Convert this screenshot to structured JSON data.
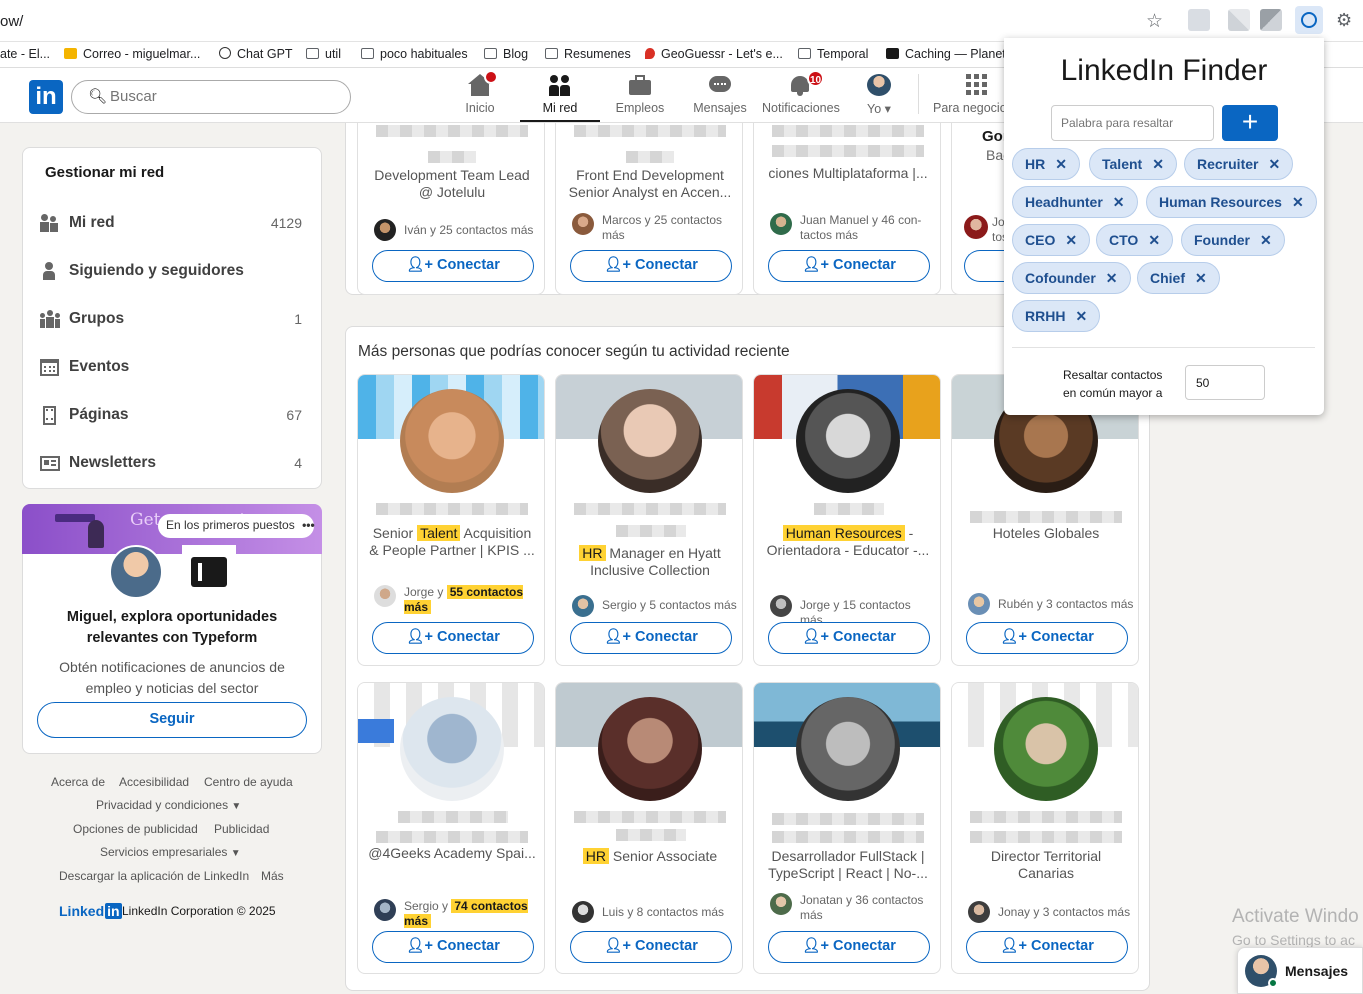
{
  "browser": {
    "url": "ow/",
    "bookmarks": [
      "ate - El...",
      "Correo - miguelmar...",
      "Chat GPT",
      "util",
      "poco habituales",
      "Blog",
      "Resumenes",
      "GeoGuessr - Let's e...",
      "Temporal",
      "Caching — PlanetS"
    ]
  },
  "nav": {
    "search_placeholder": "Buscar",
    "items": [
      {
        "label": "Inicio",
        "icon": "home-icon",
        "badge": ""
      },
      {
        "label": "Mi red",
        "icon": "network-icon",
        "badge": ""
      },
      {
        "label": "Empleos",
        "icon": "briefcase-icon",
        "badge": ""
      },
      {
        "label": "Mensajes",
        "icon": "chat-icon",
        "badge": ""
      },
      {
        "label": "Notificaciones",
        "icon": "bell-icon",
        "badge": "10"
      },
      {
        "label": "Yo",
        "icon": "avatar",
        "badge": ""
      },
      {
        "label": "Para negocios",
        "icon": "grid-icon",
        "badge": ""
      }
    ]
  },
  "sidebar": {
    "title": "Gestionar mi red",
    "items": [
      {
        "label": "Mi red",
        "count": "4129"
      },
      {
        "label": "Siguiendo y seguidores",
        "count": ""
      },
      {
        "label": "Grupos",
        "count": "1"
      },
      {
        "label": "Eventos",
        "count": ""
      },
      {
        "label": "Páginas",
        "count": "67"
      },
      {
        "label": "Newsletters",
        "count": "4"
      }
    ],
    "ad": {
      "banner_text": "Get your customers",
      "pill": "En los primeros puestos",
      "title": "Miguel, explora oportunidades relevantes con Typeform",
      "subtitle": "Obtén notificaciones de anuncios de empleo y noticias del sector",
      "button": "Seguir"
    },
    "footer": {
      "links": [
        "Acerca de",
        "Accesibilidad",
        "Centro de ayuda",
        "Privacidad y condiciones",
        "Opciones de publicidad",
        "Publicidad",
        "Servicios empresariales",
        "Descargar la aplicación de LinkedIn",
        "Más"
      ],
      "brand": "Linked",
      "brand_in": "in",
      "copyright": "LinkedIn Corporation © 2025"
    }
  },
  "top_row": [
    {
      "desc": "Development Team Lead @ Jotelulu",
      "mutual": "Iván y 25 contactos más",
      "button": "Conectar"
    },
    {
      "desc": "Front End Development Senior Analyst en Accen...",
      "mutual": "Marcos y 25 contactos más",
      "button": "Conectar"
    },
    {
      "desc": "ciones Multiplataforma |...",
      "mutual": "Juan Manuel y 46 con-tactos más",
      "button": "Conectar"
    },
    {
      "desc": "Gor",
      "desc2": "Bac",
      "mutual": "Jo tos",
      "button": "Conectar"
    }
  ],
  "section": {
    "title": "Más personas que podrías conocer según tu actividad reciente",
    "row1": [
      {
        "pre": "Senior ",
        "hl": "Talent",
        "post": " Acquisition & People Partner | KPIS ...",
        "mutual_pre": "Jorge y ",
        "mutual_hl": "55 contactos más",
        "button": "Conectar"
      },
      {
        "pre": "",
        "hl": "HR",
        "post": " Manager en Hyatt Inclusive Collection",
        "mutual_pre": "Sergio y 5 contactos más",
        "mutual_hl": "",
        "button": "Conectar"
      },
      {
        "pre": "",
        "hl": "Human Resources",
        "post": " - Orientadora - Educator -...",
        "mutual_pre": "Jorge y 15 contactos más",
        "mutual_hl": "",
        "button": "Conectar"
      },
      {
        "pre": "Hoteles Globales",
        "hl": "",
        "post": "",
        "mutual_pre": "Rubén y 3 contactos más",
        "mutual_hl": "",
        "button": "Conectar"
      }
    ],
    "row2": [
      {
        "pre": "@4Geeks Academy Spai...",
        "hl": "",
        "post": "",
        "mutual_pre": "Sergio y ",
        "mutual_hl": "74 contactos más",
        "button": "Conectar"
      },
      {
        "pre": "",
        "hl": "HR",
        "post": " Senior Associate",
        "mutual_pre": "Luis y 8 contactos más",
        "mutual_hl": "",
        "button": "Conectar"
      },
      {
        "pre": "Desarrollador FullStack | TypeScript | React | No-...",
        "hl": "",
        "post": "",
        "mutual_pre": "Jonatan y 36 contactos más",
        "mutual_hl": "",
        "button": "Conectar"
      },
      {
        "pre": "Director Territorial Canarias",
        "hl": "",
        "post": "",
        "mutual_pre": "Jonay y 3 contactos más",
        "mutual_hl": "",
        "button": "Conectar"
      }
    ]
  },
  "popup": {
    "title": "LinkedIn Finder",
    "input_placeholder": "Palabra para resaltar",
    "add_label": "+",
    "tags": [
      "HR",
      "Talent",
      "Recruiter",
      "Headhunter",
      "Human Resources",
      "CEO",
      "CTO",
      "Founder",
      "Cofounder",
      "Chief",
      "RRHH"
    ],
    "threshold_label_1": "Resaltar contactos",
    "threshold_label_2": "en común mayor a",
    "threshold_value": "50"
  },
  "overlay": {
    "activate_1": "Activate Windo",
    "activate_2": "Go to Settings to ac",
    "messages": "Mensajes"
  },
  "colors": {
    "brand": "#0a66c2",
    "highlight": "#ffd233",
    "tag_bg": "#dbe7f7",
    "badge": "#cc1016"
  }
}
